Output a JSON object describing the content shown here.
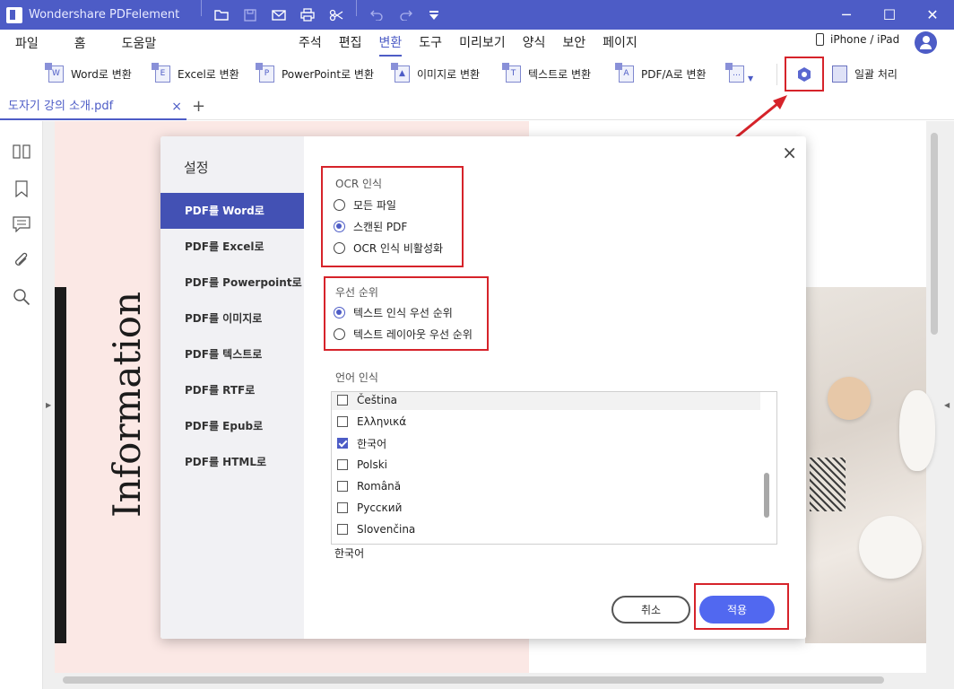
{
  "app": {
    "title": "Wondershare PDFelement"
  },
  "titlebar_icons": [
    "folder-icon",
    "save-icon",
    "mail-icon",
    "print-icon",
    "scissors-icon",
    "undo-icon",
    "redo-icon",
    "dropdown-icon"
  ],
  "menu_left": [
    "파일",
    "홈",
    "도움말"
  ],
  "menu_center": [
    "주석",
    "편집",
    "변환",
    "도구",
    "미리보기",
    "양식",
    "보안",
    "페이지"
  ],
  "active_menu": "변환",
  "device_label": "iPhone / iPad",
  "toolbar": {
    "word": "Word로 변환",
    "excel": "Excel로 변환",
    "ppt": "PowerPoint로 변환",
    "image": "이미지로 변환",
    "text": "텍스트로 변환",
    "pdfa": "PDF/A로 변환",
    "batch": "일괄 처리"
  },
  "tab": {
    "filename": "도자기 강의 소개.pdf",
    "close": "×",
    "add": "+"
  },
  "page": {
    "heading": "Information"
  },
  "dialog": {
    "title": "설정",
    "nav": [
      "PDF를 Word로",
      "PDF를 Excel로",
      "PDF를 Powerpoint로",
      "PDF를 이미지로",
      "PDF를 텍스트로",
      "PDF를 RTF로",
      "PDF를 Epub로",
      "PDF를 HTML로"
    ],
    "ocr_label": "OCR 인식",
    "ocr_options": [
      "모든 파일",
      "스캔된 PDF",
      "OCR 인식 비활성화"
    ],
    "ocr_selected": 1,
    "priority_label": "우선 순위",
    "priority_options": [
      "텍스트 인식 우선 순위",
      "텍스트 레이아웃 우선 순위"
    ],
    "priority_selected": 0,
    "lang_label": "언어 인식",
    "languages": [
      "Čeština",
      "Ελληνικά",
      "한국어",
      "Polski",
      "Română",
      "Русский",
      "Slovenčina"
    ],
    "languages_checked": [
      false,
      false,
      true,
      false,
      false,
      false,
      false
    ],
    "selected_language": "한국어",
    "cancel": "취소",
    "apply": "적용",
    "close": "×"
  },
  "colors": {
    "accent": "#4d5cc6",
    "apply_button": "#5168f0",
    "highlight": "#d6232a"
  }
}
